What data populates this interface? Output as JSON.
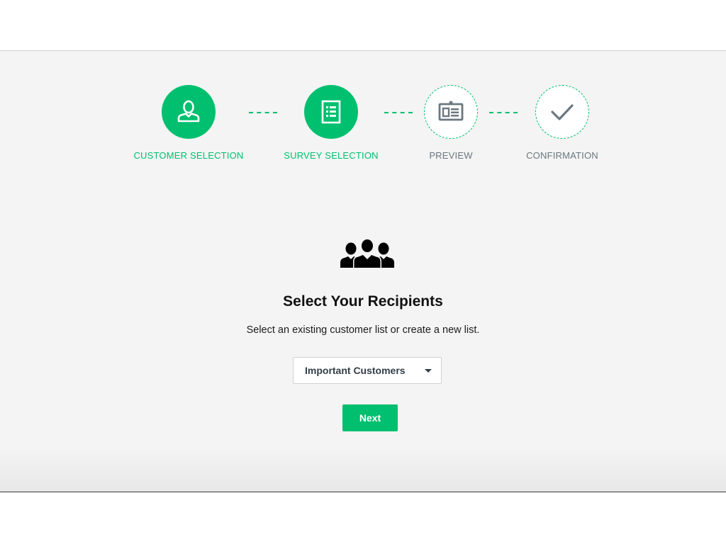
{
  "stepper": {
    "steps": [
      {
        "label": "CUSTOMER SELECTION",
        "icon": "person-icon",
        "state": "completed"
      },
      {
        "label": "SURVEY SELECTION",
        "icon": "list-document-icon",
        "state": "completed"
      },
      {
        "label": "PREVIEW",
        "icon": "id-badge-icon",
        "state": "pending"
      },
      {
        "label": "CONFIRMATION",
        "icon": "checkmark-icon",
        "state": "pending"
      }
    ]
  },
  "content": {
    "icon": "group-icon",
    "title": "Select Your Recipients",
    "subtitle": "Select an existing customer list or create a new list.",
    "list_select": {
      "selected": "Important Customers"
    },
    "next_label": "Next"
  },
  "colors": {
    "accent": "#00bf6f",
    "pending_text": "#6b787f",
    "background": "#f3f4f3"
  }
}
